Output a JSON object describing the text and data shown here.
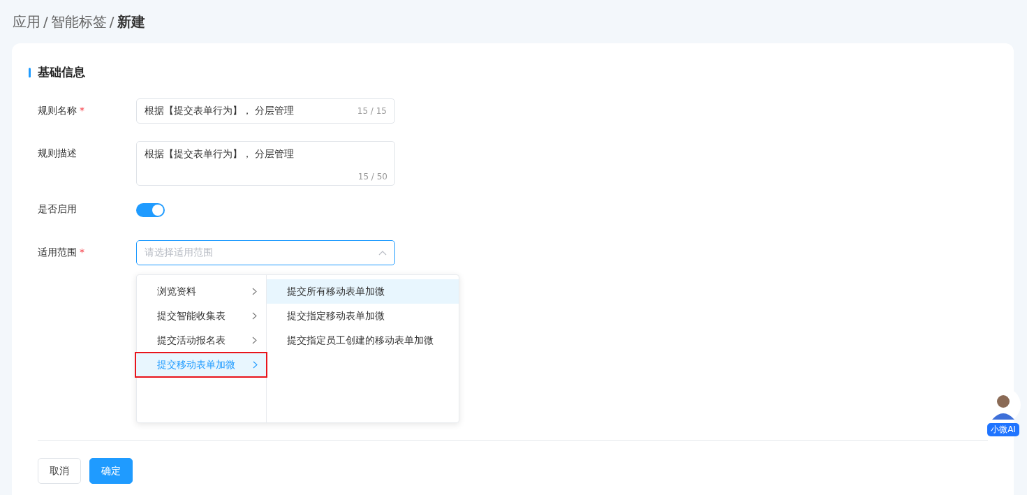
{
  "breadcrumb": [
    {
      "label": "应用",
      "kind": "link"
    },
    {
      "label": "/",
      "kind": "sep"
    },
    {
      "label": "智能标签",
      "kind": "link"
    },
    {
      "label": "/",
      "kind": "sep"
    },
    {
      "label": "新建",
      "kind": "current"
    }
  ],
  "section_title": "基础信息",
  "fields": [
    {
      "kind": "input",
      "label": "规则名称",
      "required_mark": "*",
      "value": "根据【提交表单行为】， 分层管理",
      "count": "15 / 15"
    },
    {
      "kind": "textarea",
      "label": "规则描述",
      "value": "根据【提交表单行为】， 分层管理",
      "count": "15 / 50"
    },
    {
      "kind": "switch",
      "label": "是否启用",
      "on": true
    },
    {
      "kind": "select",
      "label": "适用范围",
      "required_mark": "*",
      "placeholder": "请选择适用范围",
      "expanded": true
    }
  ],
  "cascader": {
    "level_1": [
      {
        "label": "浏览资料",
        "selected": false,
        "highlighted": false
      },
      {
        "label": "提交智能收集表",
        "selected": false,
        "highlighted": false
      },
      {
        "label": "提交活动报名表",
        "selected": false,
        "highlighted": false
      },
      {
        "label": "提交移动表单加微",
        "selected": true,
        "highlighted": true
      }
    ],
    "level_2": [
      {
        "label": "提交所有移动表单加微",
        "selected": true
      },
      {
        "label": "提交指定移动表单加微",
        "selected": false
      },
      {
        "label": "提交指定员工创建的移动表单加微",
        "selected": false
      }
    ]
  },
  "buttons": [
    {
      "label": "取消",
      "kind": "default"
    },
    {
      "label": "确定",
      "kind": "primary"
    }
  ],
  "assistant": {
    "label": "小微AI"
  }
}
